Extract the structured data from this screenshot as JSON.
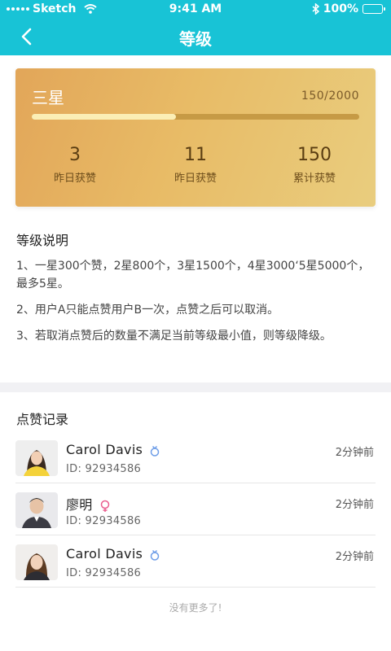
{
  "status_bar": {
    "carrier": "Sketch",
    "time": "9:41 AM",
    "battery": "100%"
  },
  "nav": {
    "title": "等级"
  },
  "level_card": {
    "level_name": "三星",
    "progress_text": "150/2000",
    "progress_fraction": 0.44,
    "stats": [
      {
        "value": "3",
        "label": "昨日获赞"
      },
      {
        "value": "11",
        "label": "昨日获赞"
      },
      {
        "value": "150",
        "label": "累计获赞"
      }
    ]
  },
  "description": {
    "title": "等级说明",
    "paragraphs": [
      "1、一星300个赞，2星800个，3星1500个，4星3000‘5星5000个，最多5星。",
      "2、用户A只能点赞用户B一次，点赞之后可以取消。",
      "3、若取消点赞后的数量不满足当前等级最小值，则等级降级。"
    ]
  },
  "records": {
    "title": "点赞记录",
    "items": [
      {
        "name": "Carol Davis",
        "gender": "male",
        "id_text": "ID:  92934586",
        "time": "2分钟前"
      },
      {
        "name": "廖明",
        "gender": "female",
        "id_text": "ID:  92934586",
        "time": "2分钟前"
      },
      {
        "name": "Carol Davis",
        "gender": "male",
        "id_text": "ID:  92934586",
        "time": "2分钟前"
      }
    ],
    "footer": "没有更多了!"
  },
  "colors": {
    "header": "#18c3d6",
    "male_icon": "#6f9ee8",
    "female_icon": "#ea5d8e"
  }
}
